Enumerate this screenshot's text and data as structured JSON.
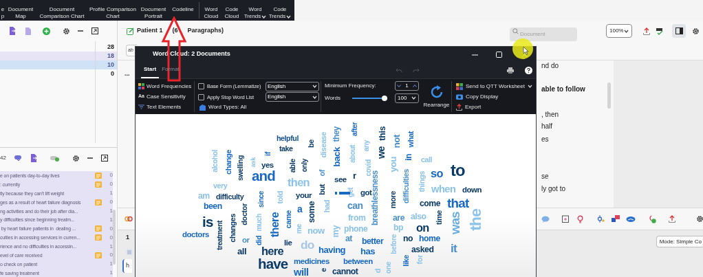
{
  "ribbon": {
    "groups": [
      [
        {
          "lines": [
            "e",
            "p"
          ],
          "dropdown": false
        },
        {
          "lines": [
            "Document",
            "Map"
          ],
          "dropdown": false
        },
        {
          "lines": [
            "Document",
            "Comparison Chart"
          ],
          "dropdown": false
        },
        {
          "lines": [
            "Profile Comparison",
            "Chart"
          ],
          "dropdown": false
        },
        {
          "lines": [
            "Document",
            "Portrait"
          ],
          "dropdown": false
        },
        {
          "lines": [
            "Codeline"
          ],
          "dropdown": false
        }
      ],
      [
        {
          "lines": [
            "Word",
            "Cloud"
          ],
          "dropdown": false
        },
        {
          "lines": [
            "Code",
            "Cloud"
          ],
          "dropdown": false
        },
        {
          "lines": [
            "Word",
            "Trends"
          ],
          "dropdown": true
        },
        {
          "lines": [
            "Code",
            "Trends"
          ],
          "dropdown": true
        }
      ]
    ]
  },
  "codes_panel": {
    "rows": [
      {
        "count": "28",
        "highlighted": false,
        "selected": false
      },
      {
        "count": "18",
        "highlighted": true,
        "selected": false
      },
      {
        "count": "10",
        "highlighted": false,
        "selected": true
      },
      {
        "count": "0",
        "highlighted": false,
        "selected": false
      }
    ]
  },
  "segments_panel": {
    "count": "42",
    "rows": [
      {
        "text": "e on patients day-to-day lives",
        "memo": true,
        "count": "0"
      },
      {
        "text": ": currently",
        "memo": true,
        "count": "0"
      },
      {
        "text": "tly because they can't lift weight",
        "memo": false,
        "count": "1"
      },
      {
        "text": "ges as a result of heart failure diagnosis",
        "memo": true,
        "count": "0"
      },
      {
        "text": "ng activities and do their job after dia...",
        "memo": false,
        "count": "1"
      },
      {
        "text": "y difficulties since beginning treatm...",
        "memo": false,
        "count": "1"
      },
      {
        "text": " by heart failure patients in  dealing ...",
        "memo": true,
        "count": "0"
      },
      {
        "text": "culties in accessing services in curren...",
        "memo": true,
        "count": "0"
      },
      {
        "text": "rience and no difficulties in accessin...",
        "memo": false,
        "count": "1"
      },
      {
        "text": "evel of care received",
        "memo": true,
        "count": "0"
      },
      {
        "text": "o check on patient",
        "memo": false,
        "count": "1"
      },
      {
        "text": "fe saving treatment",
        "memo": false,
        "count": "1"
      }
    ]
  },
  "document": {
    "title": "Patient 1",
    "paragraphs_start": "(6",
    "paragraphs_end": "Paragraphs)",
    "field_value": "ab",
    "more": "...",
    "search_placeholder": "Document",
    "zoom": "100%",
    "lines": [
      {
        "text": "nd do",
        "bold": false
      },
      {
        "text": "able to follow",
        "bold": true
      },
      {
        "text": ", then",
        "bold": false
      },
      {
        "text": "half",
        "bold": false
      },
      {
        "text": "es",
        "bold": false
      },
      {
        "text": "se",
        "bold": false
      },
      {
        "text": "ly got to",
        "bold": false
      }
    ],
    "bottom_number": "1",
    "bottom_field": "h"
  },
  "tooltip": "Mode: Simple Co",
  "dialog": {
    "title": "Word Cloud: 2 Documents",
    "tabs": [
      {
        "label": "Start",
        "selected": true
      },
      {
        "label": "Format",
        "selected": false
      }
    ],
    "view_options": [
      {
        "label": "Word Frequencies"
      },
      {
        "label": "Case Sensitivity",
        "glyph": "Aa"
      },
      {
        "label": "Text Elements"
      }
    ],
    "base_form": {
      "label": "Base Form (Lemmatize)",
      "checked": false,
      "language": "English"
    },
    "stop_words": {
      "label": "Apply Stop Word List",
      "checked": false,
      "language": "English"
    },
    "word_types": "Word Types: All",
    "min_frequency": {
      "label": "Minimum Frequency:",
      "value": "1"
    },
    "word_count": {
      "label": "Words",
      "level": 0.95,
      "value": "100"
    },
    "rearrange": "Rearrange",
    "actions": [
      {
        "label": "Send to QTT Worksheet",
        "dropdown": true
      },
      {
        "label": "Copy Display",
        "dropdown": false
      },
      {
        "label": "Export",
        "dropdown": false
      }
    ],
    "cloud_words": [
      {
        "text": "helpful",
        "color": "#11508f",
        "vertical": false
      },
      {
        "text": "take",
        "color": "#0b3a66",
        "vertical": false
      },
      {
        "text": "be",
        "color": "#0b3a66",
        "vertical": true
      },
      {
        "text": "disease",
        "color": "#8cc3e8",
        "vertical": true
      },
      {
        "text": "back",
        "color": "#1769c4",
        "vertical": true
      },
      {
        "text": "they",
        "color": "#4b8fc9",
        "vertical": true
      },
      {
        "text": "after",
        "color": "#1769c4",
        "vertical": true
      },
      {
        "text": "about",
        "color": "#8cc3e8",
        "vertical": true
      },
      {
        "text": "any",
        "color": "#8cc3e8",
        "vertical": true
      },
      {
        "text": "covid",
        "color": "#8cc3e8",
        "vertical": true
      },
      {
        "text": "this",
        "color": "#0b3a66",
        "vertical": true
      },
      {
        "text": "we",
        "color": "#0b3a66",
        "vertical": true
      },
      {
        "text": "not",
        "color": "#4b8fc9",
        "vertical": true
      },
      {
        "text": "you",
        "color": "#8cc3e8",
        "vertical": true
      },
      {
        "text": "what",
        "color": "#1769c4",
        "vertical": true
      },
      {
        "text": "in",
        "color": "#1769c4",
        "vertical": true
      },
      {
        "text": "call",
        "color": "#8cc3e8",
        "vertical": false
      },
      {
        "text": "alcohol",
        "color": "#8cc3e8",
        "vertical": true
      },
      {
        "text": "change",
        "color": "#1769c4",
        "vertical": true
      },
      {
        "text": "swelling",
        "color": "#0b3a66",
        "vertical": true
      },
      {
        "text": "ask",
        "color": "#8cc3e8",
        "vertical": true
      },
      {
        "text": "if",
        "color": "#1769c4",
        "vertical": true
      },
      {
        "text": "yes",
        "color": "#0b3a66",
        "vertical": false
      },
      {
        "text": "able",
        "color": "#0b3a66",
        "vertical": true
      },
      {
        "text": "only",
        "color": "#0b3a66",
        "vertical": true
      },
      {
        "text": "of",
        "color": "#4b8fc9",
        "vertical": true
      },
      {
        "text": "and",
        "color": "#1769c4",
        "vertical": false
      },
      {
        "text": "then",
        "color": "#8cc3e8",
        "vertical": false
      },
      {
        "text": "very",
        "color": "#8cc3e8",
        "vertical": false
      },
      {
        "text": "am",
        "color": "#8cc3e8",
        "vertical": false
      },
      {
        "text": "difficulty",
        "color": "#0b3a66",
        "vertical": false
      },
      {
        "text": "since",
        "color": "#1769c4",
        "vertical": true
      },
      {
        "text": "told",
        "color": "#8cc3e8",
        "vertical": true
      },
      {
        "text": "your",
        "color": "#0b3a66",
        "vertical": false
      },
      {
        "text": "but",
        "color": "#0b3a66",
        "vertical": true
      },
      {
        "text": "see",
        "color": "#0b3a66",
        "vertical": false
      },
      {
        "text": "r",
        "color": "#0b3a66",
        "vertical": false
      },
      {
        "text": "get",
        "color": "#8cc3e8",
        "vertical": true
      },
      {
        "text": "got",
        "color": "#0b3a66",
        "vertical": false
      },
      {
        "text": "breathlessness",
        "color": "#4b8fc9",
        "vertical": true
      },
      {
        "text": "difficulties",
        "color": "#4b8fc9",
        "vertical": true
      },
      {
        "text": "things",
        "color": "#8cc3e8",
        "vertical": true
      },
      {
        "text": "so",
        "color": "#1769c4",
        "vertical": false
      },
      {
        "text": "to",
        "color": "#0b3a66",
        "vertical": false
      },
      {
        "text": "when",
        "color": "#8cc3e8",
        "vertical": false
      },
      {
        "text": "down",
        "color": "#0b3a66",
        "vertical": false
      },
      {
        "text": "more",
        "color": "#0b3a66",
        "vertical": true
      },
      {
        "text": "i",
        "color": "#1769c4",
        "vertical": true
      },
      {
        "text": "can",
        "color": "#4b8fc9",
        "vertical": false
      },
      {
        "text": "from",
        "color": "#8cc3e8",
        "vertical": false
      },
      {
        "text": "phone",
        "color": "#8cc3e8",
        "vertical": false
      },
      {
        "text": "my",
        "color": "#8cc3e8",
        "vertical": true
      },
      {
        "text": "had",
        "color": "#8cc3e8",
        "vertical": true
      },
      {
        "text": "some",
        "color": "#0b3a66",
        "vertical": true
      },
      {
        "text": "a",
        "color": "#1769c4",
        "vertical": false
      },
      {
        "text": "came",
        "color": "#1769c4",
        "vertical": true
      },
      {
        "text": "me",
        "color": "#8cc3e8",
        "vertical": true
      },
      {
        "text": "now",
        "color": "#8cc3e8",
        "vertical": false
      },
      {
        "text": "there",
        "color": "#1769c4",
        "vertical": true
      },
      {
        "text": "did",
        "color": "#1769c4",
        "vertical": true
      },
      {
        "text": "much",
        "color": "#8cc3e8",
        "vertical": true
      },
      {
        "text": "doctor",
        "color": "#0b3a66",
        "vertical": true
      },
      {
        "text": "changes",
        "color": "#0b3a66",
        "vertical": true
      },
      {
        "text": "treatment",
        "color": "#0b3a66",
        "vertical": true
      },
      {
        "text": "been",
        "color": "#1769c4",
        "vertical": false
      },
      {
        "text": "is",
        "color": "#0b3a66",
        "vertical": false
      },
      {
        "text": "doctors",
        "color": "#1769c4",
        "vertical": false
      },
      {
        "text": "or",
        "color": "#4b8fc9",
        "vertical": false
      },
      {
        "text": "all",
        "color": "#0b3a66",
        "vertical": false
      },
      {
        "text": "lie",
        "color": "#0b3a66",
        "vertical": false
      },
      {
        "text": "here",
        "color": "#0b3a66",
        "vertical": false
      },
      {
        "text": "do",
        "color": "#a6c6e2",
        "vertical": false
      },
      {
        "text": "having",
        "color": "#1769c4",
        "vertical": false
      },
      {
        "text": "at",
        "color": "#4b8fc9",
        "vertical": false
      },
      {
        "text": "better",
        "color": "#1769c4",
        "vertical": false
      },
      {
        "text": "has",
        "color": "#1769c4",
        "vertical": false
      },
      {
        "text": "have",
        "color": "#0b3a66",
        "vertical": false
      },
      {
        "text": "medicines",
        "color": "#1769c4",
        "vertical": false
      },
      {
        "text": "between",
        "color": "#1769c4",
        "vertical": false
      },
      {
        "text": "will",
        "color": "#1769c4",
        "vertical": false
      },
      {
        "text": "e",
        "color": "#0b3a66",
        "vertical": true
      },
      {
        "text": "cannot",
        "color": "#0b3a66",
        "vertical": false
      },
      {
        "text": "d",
        "color": "#8cc3e8",
        "vertical": true
      },
      {
        "text": "one",
        "color": "#8cc3e8",
        "vertical": true
      },
      {
        "text": "before",
        "color": "#8cc3e8",
        "vertical": true
      },
      {
        "text": "are",
        "color": "#4b8fc9",
        "vertical": false
      },
      {
        "text": "bp",
        "color": "#8cc3e8",
        "vertical": false
      },
      {
        "text": "also",
        "color": "#8cc3e8",
        "vertical": false
      },
      {
        "text": "come",
        "color": "#0b3a66",
        "vertical": false
      },
      {
        "text": "time",
        "color": "#0b3a66",
        "vertical": true
      },
      {
        "text": "that",
        "color": "#1769c4",
        "vertical": false
      },
      {
        "text": "on",
        "color": "#0b3a66",
        "vertical": false
      },
      {
        "text": "no",
        "color": "#0b3a66",
        "vertical": false
      },
      {
        "text": "home",
        "color": "#1769c4",
        "vertical": false
      },
      {
        "text": "like",
        "color": "#1769c4",
        "vertical": true
      },
      {
        "text": "for",
        "color": "#8cc3e8",
        "vertical": true
      },
      {
        "text": "asked",
        "color": "#0b3a66",
        "vertical": false
      },
      {
        "text": "it",
        "color": "#4b8fc9",
        "vertical": false
      },
      {
        "text": "was",
        "color": "#6aaee0",
        "vertical": true
      },
      {
        "text": "the",
        "color": "#8cc3e8",
        "vertical": true
      }
    ]
  }
}
